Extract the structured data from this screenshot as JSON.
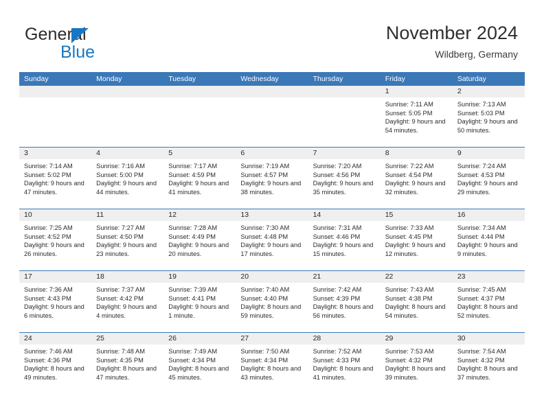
{
  "brand": {
    "name_top": "General",
    "name_bottom": "Blue",
    "triangle_color": "#1877c4",
    "text_color": "#2b2b2b"
  },
  "header": {
    "title": "November 2024",
    "subtitle": "Wildberg, Germany"
  },
  "colors": {
    "header_blue": "#3b78b8",
    "date_band_gray": "#efefef",
    "text": "#2b2b2b",
    "header_text": "#ffffff"
  },
  "weekday_headers": [
    "Sunday",
    "Monday",
    "Tuesday",
    "Wednesday",
    "Thursday",
    "Friday",
    "Saturday"
  ],
  "labels": {
    "sunrise_prefix": "Sunrise:",
    "sunset_prefix": "Sunset:",
    "daylight_prefix": "Daylight:"
  },
  "weeks": [
    [
      {
        "day": "",
        "empty": true
      },
      {
        "day": "",
        "empty": true
      },
      {
        "day": "",
        "empty": true
      },
      {
        "day": "",
        "empty": true
      },
      {
        "day": "",
        "empty": true
      },
      {
        "day": "1",
        "sunrise": "Sunrise: 7:11 AM",
        "sunset": "Sunset: 5:05 PM",
        "daylight": "Daylight: 9 hours and 54 minutes."
      },
      {
        "day": "2",
        "sunrise": "Sunrise: 7:13 AM",
        "sunset": "Sunset: 5:03 PM",
        "daylight": "Daylight: 9 hours and 50 minutes."
      }
    ],
    [
      {
        "day": "3",
        "sunrise": "Sunrise: 7:14 AM",
        "sunset": "Sunset: 5:02 PM",
        "daylight": "Daylight: 9 hours and 47 minutes."
      },
      {
        "day": "4",
        "sunrise": "Sunrise: 7:16 AM",
        "sunset": "Sunset: 5:00 PM",
        "daylight": "Daylight: 9 hours and 44 minutes."
      },
      {
        "day": "5",
        "sunrise": "Sunrise: 7:17 AM",
        "sunset": "Sunset: 4:59 PM",
        "daylight": "Daylight: 9 hours and 41 minutes."
      },
      {
        "day": "6",
        "sunrise": "Sunrise: 7:19 AM",
        "sunset": "Sunset: 4:57 PM",
        "daylight": "Daylight: 9 hours and 38 minutes."
      },
      {
        "day": "7",
        "sunrise": "Sunrise: 7:20 AM",
        "sunset": "Sunset: 4:56 PM",
        "daylight": "Daylight: 9 hours and 35 minutes."
      },
      {
        "day": "8",
        "sunrise": "Sunrise: 7:22 AM",
        "sunset": "Sunset: 4:54 PM",
        "daylight": "Daylight: 9 hours and 32 minutes."
      },
      {
        "day": "9",
        "sunrise": "Sunrise: 7:24 AM",
        "sunset": "Sunset: 4:53 PM",
        "daylight": "Daylight: 9 hours and 29 minutes."
      }
    ],
    [
      {
        "day": "10",
        "sunrise": "Sunrise: 7:25 AM",
        "sunset": "Sunset: 4:52 PM",
        "daylight": "Daylight: 9 hours and 26 minutes."
      },
      {
        "day": "11",
        "sunrise": "Sunrise: 7:27 AM",
        "sunset": "Sunset: 4:50 PM",
        "daylight": "Daylight: 9 hours and 23 minutes."
      },
      {
        "day": "12",
        "sunrise": "Sunrise: 7:28 AM",
        "sunset": "Sunset: 4:49 PM",
        "daylight": "Daylight: 9 hours and 20 minutes."
      },
      {
        "day": "13",
        "sunrise": "Sunrise: 7:30 AM",
        "sunset": "Sunset: 4:48 PM",
        "daylight": "Daylight: 9 hours and 17 minutes."
      },
      {
        "day": "14",
        "sunrise": "Sunrise: 7:31 AM",
        "sunset": "Sunset: 4:46 PM",
        "daylight": "Daylight: 9 hours and 15 minutes."
      },
      {
        "day": "15",
        "sunrise": "Sunrise: 7:33 AM",
        "sunset": "Sunset: 4:45 PM",
        "daylight": "Daylight: 9 hours and 12 minutes."
      },
      {
        "day": "16",
        "sunrise": "Sunrise: 7:34 AM",
        "sunset": "Sunset: 4:44 PM",
        "daylight": "Daylight: 9 hours and 9 minutes."
      }
    ],
    [
      {
        "day": "17",
        "sunrise": "Sunrise: 7:36 AM",
        "sunset": "Sunset: 4:43 PM",
        "daylight": "Daylight: 9 hours and 6 minutes."
      },
      {
        "day": "18",
        "sunrise": "Sunrise: 7:37 AM",
        "sunset": "Sunset: 4:42 PM",
        "daylight": "Daylight: 9 hours and 4 minutes."
      },
      {
        "day": "19",
        "sunrise": "Sunrise: 7:39 AM",
        "sunset": "Sunset: 4:41 PM",
        "daylight": "Daylight: 9 hours and 1 minute."
      },
      {
        "day": "20",
        "sunrise": "Sunrise: 7:40 AM",
        "sunset": "Sunset: 4:40 PM",
        "daylight": "Daylight: 8 hours and 59 minutes."
      },
      {
        "day": "21",
        "sunrise": "Sunrise: 7:42 AM",
        "sunset": "Sunset: 4:39 PM",
        "daylight": "Daylight: 8 hours and 56 minutes."
      },
      {
        "day": "22",
        "sunrise": "Sunrise: 7:43 AM",
        "sunset": "Sunset: 4:38 PM",
        "daylight": "Daylight: 8 hours and 54 minutes."
      },
      {
        "day": "23",
        "sunrise": "Sunrise: 7:45 AM",
        "sunset": "Sunset: 4:37 PM",
        "daylight": "Daylight: 8 hours and 52 minutes."
      }
    ],
    [
      {
        "day": "24",
        "sunrise": "Sunrise: 7:46 AM",
        "sunset": "Sunset: 4:36 PM",
        "daylight": "Daylight: 8 hours and 49 minutes."
      },
      {
        "day": "25",
        "sunrise": "Sunrise: 7:48 AM",
        "sunset": "Sunset: 4:35 PM",
        "daylight": "Daylight: 8 hours and 47 minutes."
      },
      {
        "day": "26",
        "sunrise": "Sunrise: 7:49 AM",
        "sunset": "Sunset: 4:34 PM",
        "daylight": "Daylight: 8 hours and 45 minutes."
      },
      {
        "day": "27",
        "sunrise": "Sunrise: 7:50 AM",
        "sunset": "Sunset: 4:34 PM",
        "daylight": "Daylight: 8 hours and 43 minutes."
      },
      {
        "day": "28",
        "sunrise": "Sunrise: 7:52 AM",
        "sunset": "Sunset: 4:33 PM",
        "daylight": "Daylight: 8 hours and 41 minutes."
      },
      {
        "day": "29",
        "sunrise": "Sunrise: 7:53 AM",
        "sunset": "Sunset: 4:32 PM",
        "daylight": "Daylight: 8 hours and 39 minutes."
      },
      {
        "day": "30",
        "sunrise": "Sunrise: 7:54 AM",
        "sunset": "Sunset: 4:32 PM",
        "daylight": "Daylight: 8 hours and 37 minutes."
      }
    ]
  ]
}
